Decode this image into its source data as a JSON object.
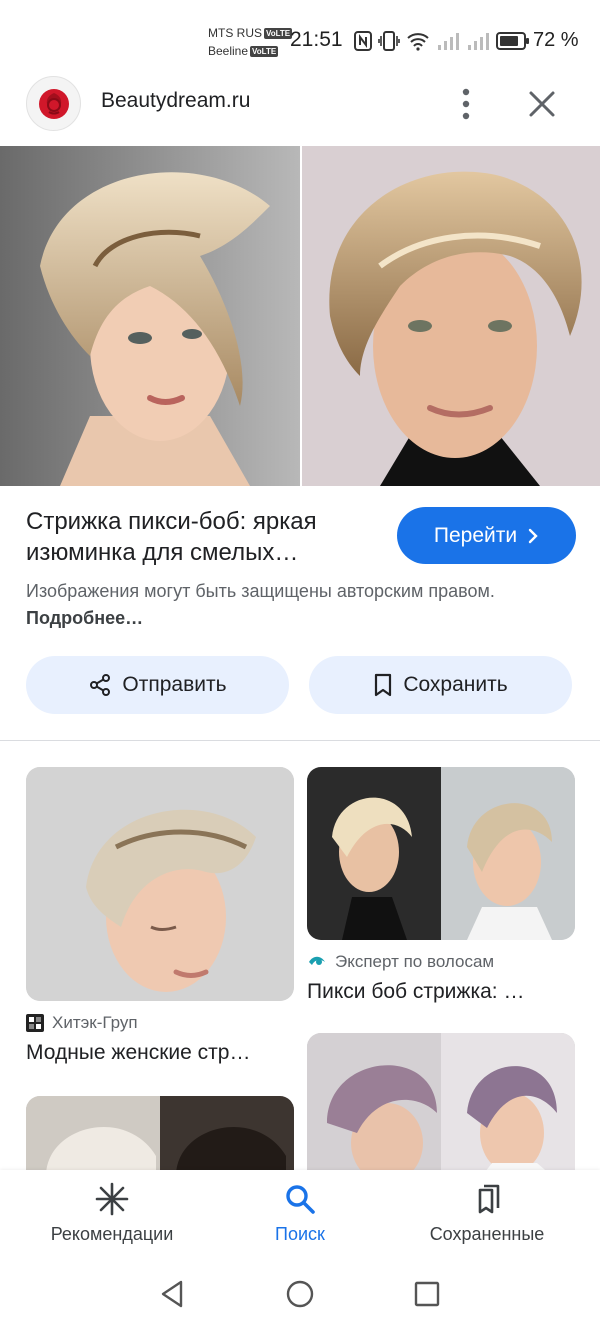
{
  "status_bar": {
    "carrier_1": "MTS RUS",
    "carrier_2": "Beeline",
    "volte": "VoLTE",
    "time": "21:51",
    "battery": "72 %"
  },
  "header": {
    "site_name": "Beautydream.ru",
    "icons": [
      "more-vert-icon",
      "close-icon"
    ]
  },
  "result": {
    "title": "Стрижка пикси-боб: яркая изюминка для смелых…",
    "go_button": "Перейти",
    "copyright_text": "Изображения могут быть защищены авторским правом.",
    "more_link": "Подробнее…",
    "share_button": "Отправить",
    "save_button": "Сохранить"
  },
  "related": [
    {
      "source": "Хитэк-Груп",
      "caption": "Модные женские стр…"
    },
    {
      "source": "Эксперт по волосам",
      "caption": "Пикси боб стрижка: …"
    }
  ],
  "bottom_nav": {
    "items": [
      {
        "label": "Рекомендации",
        "icon": "asterisk-icon"
      },
      {
        "label": "Поиск",
        "icon": "search-icon"
      },
      {
        "label": "Сохраненные",
        "icon": "saved-collections-icon"
      }
    ],
    "active": "Поиск"
  },
  "colors": {
    "accent": "#1a73e8",
    "pill_bg": "#e8f0fe",
    "text": "#202124",
    "muted": "#5f6368"
  }
}
